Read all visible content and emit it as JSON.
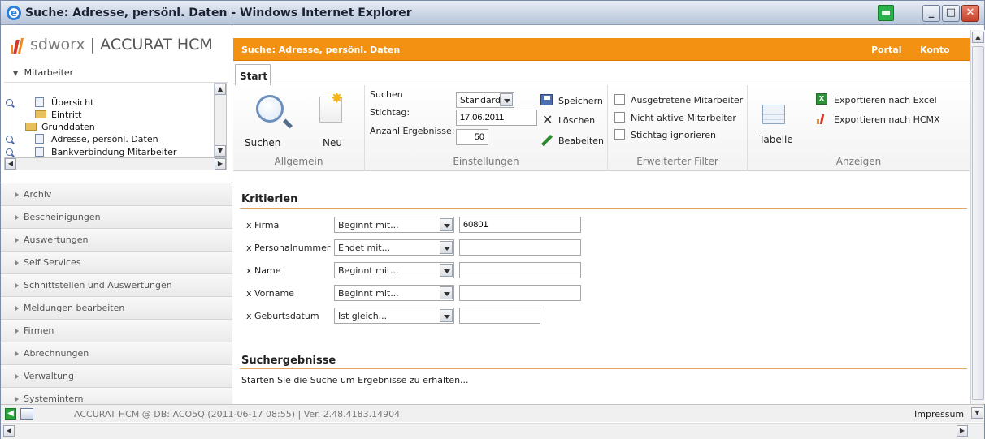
{
  "window": {
    "title": "Suche: Adresse, persönl. Daten - Windows Internet Explorer",
    "min_glyph": "_",
    "max_glyph": "□",
    "close_glyph": "✕"
  },
  "brand": {
    "logo_text": "sdworx",
    "separator": " | ",
    "product": "ACCURAT HCM"
  },
  "sidebar": {
    "section": "Mitarbeiter",
    "tree": [
      {
        "label": "Übersicht",
        "icon": "document-icon"
      },
      {
        "label": "Eintritt",
        "icon": "folder-icon"
      },
      {
        "label": "Grunddaten",
        "icon": "folder-open-icon"
      },
      {
        "label": "Adresse, persönl. Daten",
        "icon": "document-icon"
      },
      {
        "label": "Bankverbindung Mitarbeiter",
        "icon": "document-icon"
      }
    ],
    "nav": [
      "Archiv",
      "Bescheinigungen",
      "Auswertungen",
      "Self Services",
      "Schnittstellen und Auswertungen",
      "Meldungen bearbeiten",
      "Firmen",
      "Abrechnungen",
      "Verwaltung",
      "Systemintern"
    ]
  },
  "header": {
    "title": "Suche: Adresse, persönl. Daten",
    "portal": "Portal",
    "konto": "Konto"
  },
  "tab": {
    "start": "Start"
  },
  "ribbon": {
    "allgemein": {
      "label": "Allgemein",
      "suchen": "Suchen",
      "neu": "Neu"
    },
    "einstellungen": {
      "label": "Einstellungen",
      "suchen_label": "Suchen",
      "suchen_value": "Standard",
      "stichtag_label": "Stichtag:",
      "stichtag_value": "17.06.2011",
      "anzahl_label": "Anzahl Ergebnisse:",
      "anzahl_value": "50",
      "speichern": "Speichern",
      "loeschen": "Löschen",
      "bearbeiten": "Beabeiten"
    },
    "filter": {
      "label": "Erweiterter Filter",
      "opt1": "Ausgetretene Mitarbeiter",
      "opt2": "Nicht aktive Mitarbeiter",
      "opt3": "Stichtag ignorieren"
    },
    "anzeigen": {
      "label": "Anzeigen",
      "tabelle": "Tabelle",
      "excel": "Exportieren nach Excel",
      "hcmx": "Exportieren nach HCMX"
    }
  },
  "kriterien": {
    "title": "Kritierien",
    "rows": [
      {
        "label": "x Firma",
        "op": "Beginnt mit...",
        "value": "60801"
      },
      {
        "label": "x Personalnummer",
        "op": "Endet mit...",
        "value": ""
      },
      {
        "label": "x Name",
        "op": "Beginnt mit...",
        "value": ""
      },
      {
        "label": "x Vorname",
        "op": "Beginnt mit...",
        "value": ""
      },
      {
        "label": "x Geburtsdatum",
        "op": "Ist gleich...",
        "value": ""
      }
    ]
  },
  "ergebnisse": {
    "title": "Suchergebnisse",
    "hint": "Starten Sie die Suche um Ergebnisse zu erhalten..."
  },
  "status": {
    "text": "ACCURAT HCM @ DB: ACO5Q (2011-06-17 08:55) | Ver. 2.48.4183.14904",
    "impressum": "Impressum"
  },
  "colors": {
    "accent": "#f39212",
    "link": "#ffffff"
  }
}
